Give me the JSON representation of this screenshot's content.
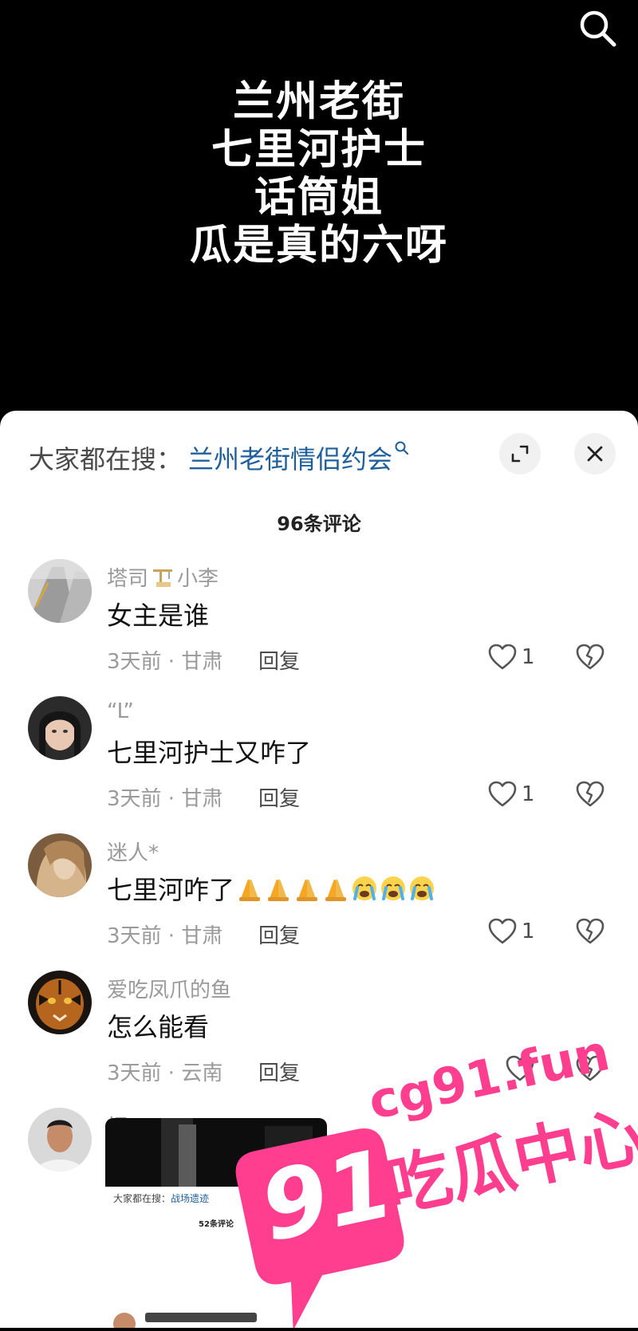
{
  "video": {
    "overlay_lines": [
      "兰州老街",
      "七里河护士",
      "话筒姐",
      "瓜是真的六呀"
    ],
    "search_icon": "search-icon"
  },
  "panel": {
    "hot_search_prefix": "大家都在搜：",
    "hot_search_query": "兰州老街情侣约会",
    "expand_icon": "expand-icon",
    "close_icon": "close-icon",
    "comment_count": "96条评论"
  },
  "comments": [
    {
      "username": "塔司",
      "username_suffix": "小李",
      "text": "女主是谁",
      "time_location": "3天前 · 甘肃",
      "reply": "回复",
      "likes": "1"
    },
    {
      "username": "“L”",
      "text": "七里河护士又咋了",
      "time_location": "3天前 · 甘肃",
      "reply": "回复",
      "likes": "1"
    },
    {
      "username": "迷人*",
      "text": "七里河咋了",
      "time_location": "3天前 · 甘肃",
      "reply": "回复",
      "likes": "1"
    },
    {
      "username": "爱吃凤爪的鱼",
      "text": "怎么能看",
      "time_location": "3天前 · 云南",
      "reply": "回复",
      "likes": ""
    },
    {
      "username": "桐"
    }
  ],
  "thumbnail": {
    "hot_search_prefix": "大家都在搜：",
    "hot_search_query": "战场遗迹",
    "comment_count": "52条评论"
  },
  "watermark": {
    "number": "91",
    "domain": "cg91.fun",
    "slogan": "吃瓜中心"
  },
  "colors": {
    "link_blue": "#1f5f9c",
    "watermark_pink": "#ff3e8f"
  }
}
